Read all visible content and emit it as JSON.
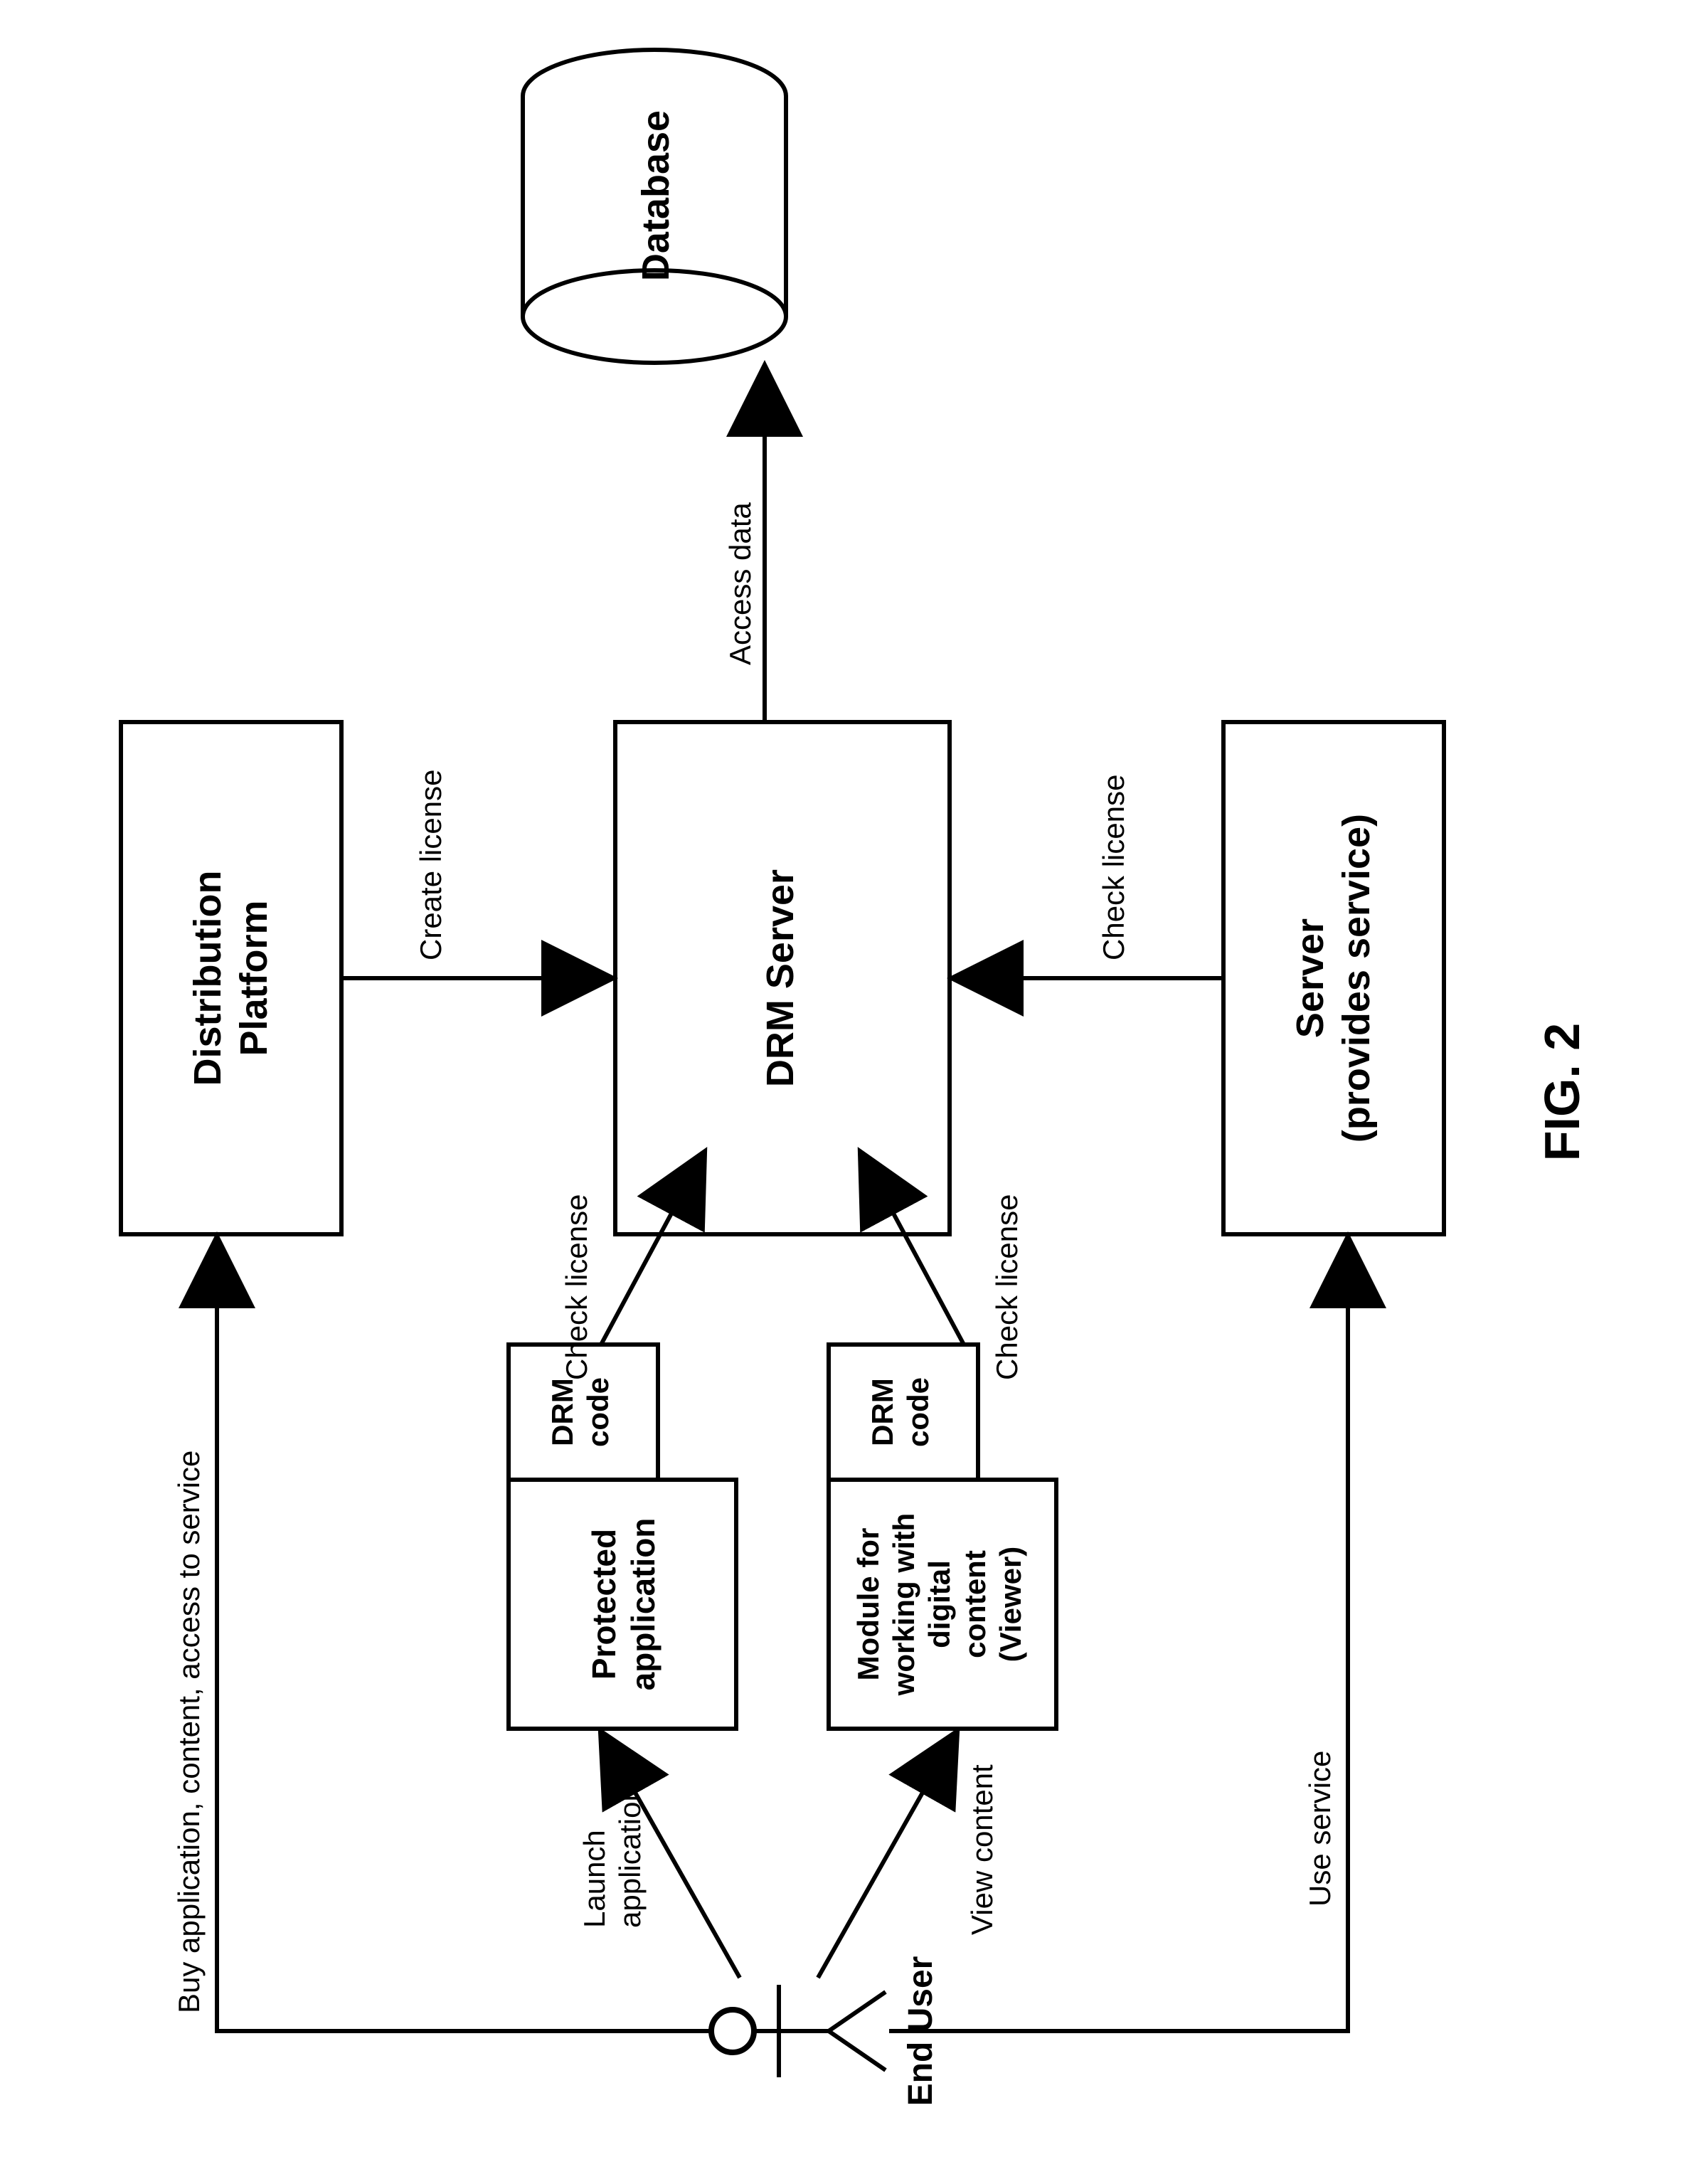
{
  "figure": "FIG. 2",
  "actor": "End User",
  "nodes": {
    "distribution": [
      "Distribution",
      "Platform"
    ],
    "drm": "DRM Server",
    "server": [
      "Server",
      "(provides service)"
    ],
    "database": "Database",
    "protected": [
      "Protected",
      "application"
    ],
    "drmcode": [
      "DRM",
      "code"
    ],
    "viewer": [
      "Module for",
      "working with",
      "digital",
      "content",
      "(Viewer)"
    ]
  },
  "edges": {
    "buy": "Buy application, content, access to service",
    "launch": [
      "Launch",
      "application"
    ],
    "view": "View content",
    "use": "Use service",
    "check": "Check license",
    "create": "Create license",
    "access": "Access data"
  }
}
